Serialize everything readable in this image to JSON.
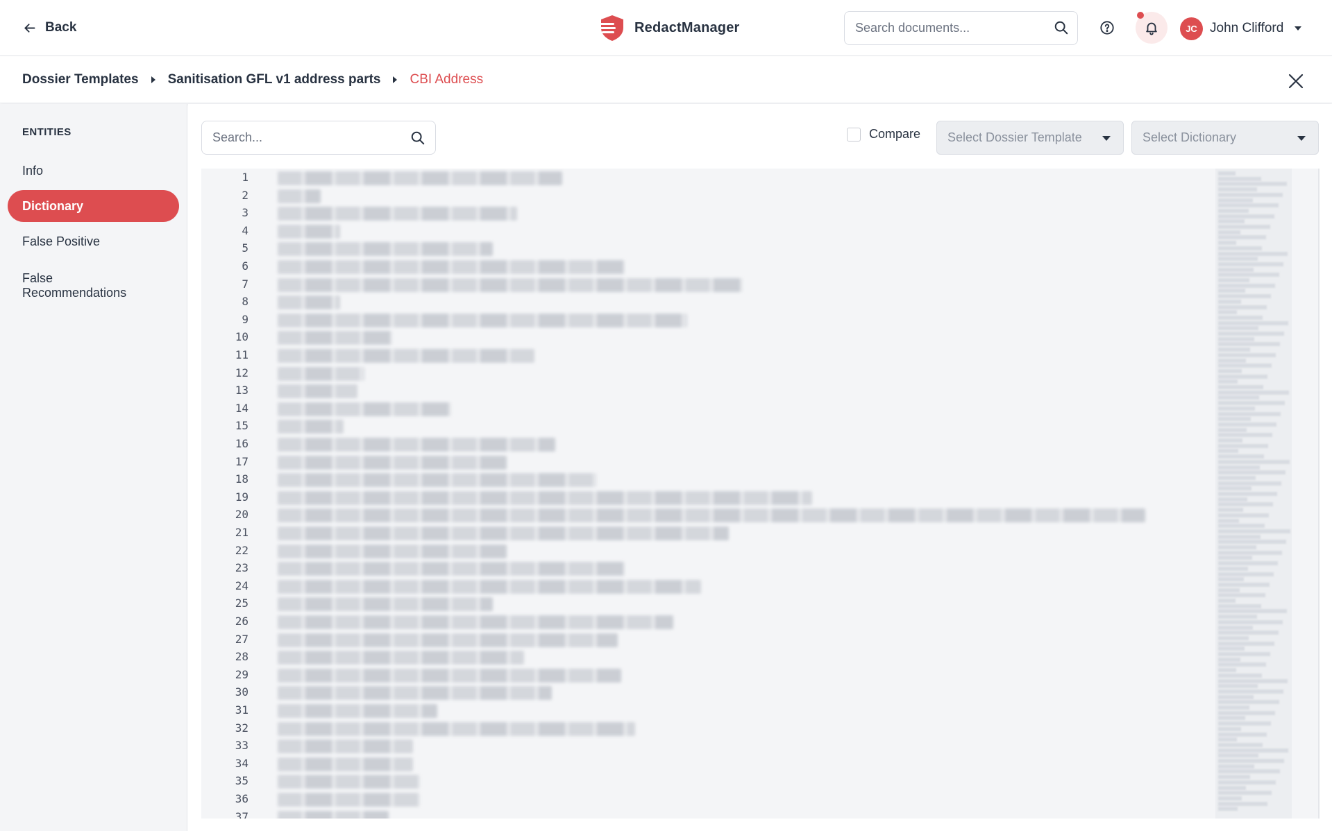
{
  "header": {
    "back_label": "Back",
    "app_name": "RedactManager",
    "search_placeholder": "Search documents...",
    "user": {
      "initials": "JC",
      "name": "John Clifford"
    },
    "brand_color": "#dd4d50",
    "icons": [
      "arrow-left-icon",
      "logo-icon",
      "search-icon",
      "help-icon",
      "bell-icon",
      "chevron-down-icon"
    ]
  },
  "breadcrumb": {
    "items": [
      "Dossier Templates",
      "Sanitisation GFL v1 address parts",
      "CBI Address"
    ]
  },
  "sidebar": {
    "title": "ENTITIES",
    "items": [
      {
        "label": "Info",
        "active": false
      },
      {
        "label": "Dictionary",
        "active": true
      },
      {
        "label": "False Positive",
        "active": false
      },
      {
        "label": "False Recommendations",
        "active": false
      }
    ]
  },
  "toolbar": {
    "search_placeholder": "Search...",
    "compare_label": "Compare",
    "compare_checked": false,
    "select_template_placeholder": "Select Dossier Template",
    "select_dictionary_placeholder": "Select Dictionary"
  },
  "editor": {
    "line_numbers": [
      "1",
      "2",
      "3",
      "4",
      "5",
      "6",
      "7",
      "8",
      "9",
      "10",
      "11",
      "12",
      "13",
      "14",
      "15",
      "16",
      "17",
      "18",
      "19",
      "20",
      "21",
      "22",
      "23",
      "24",
      "25",
      "26",
      "27",
      "28",
      "29",
      "30",
      "31",
      "32",
      "33",
      "34",
      "35",
      "36",
      "37"
    ],
    "content_blurred": true
  }
}
